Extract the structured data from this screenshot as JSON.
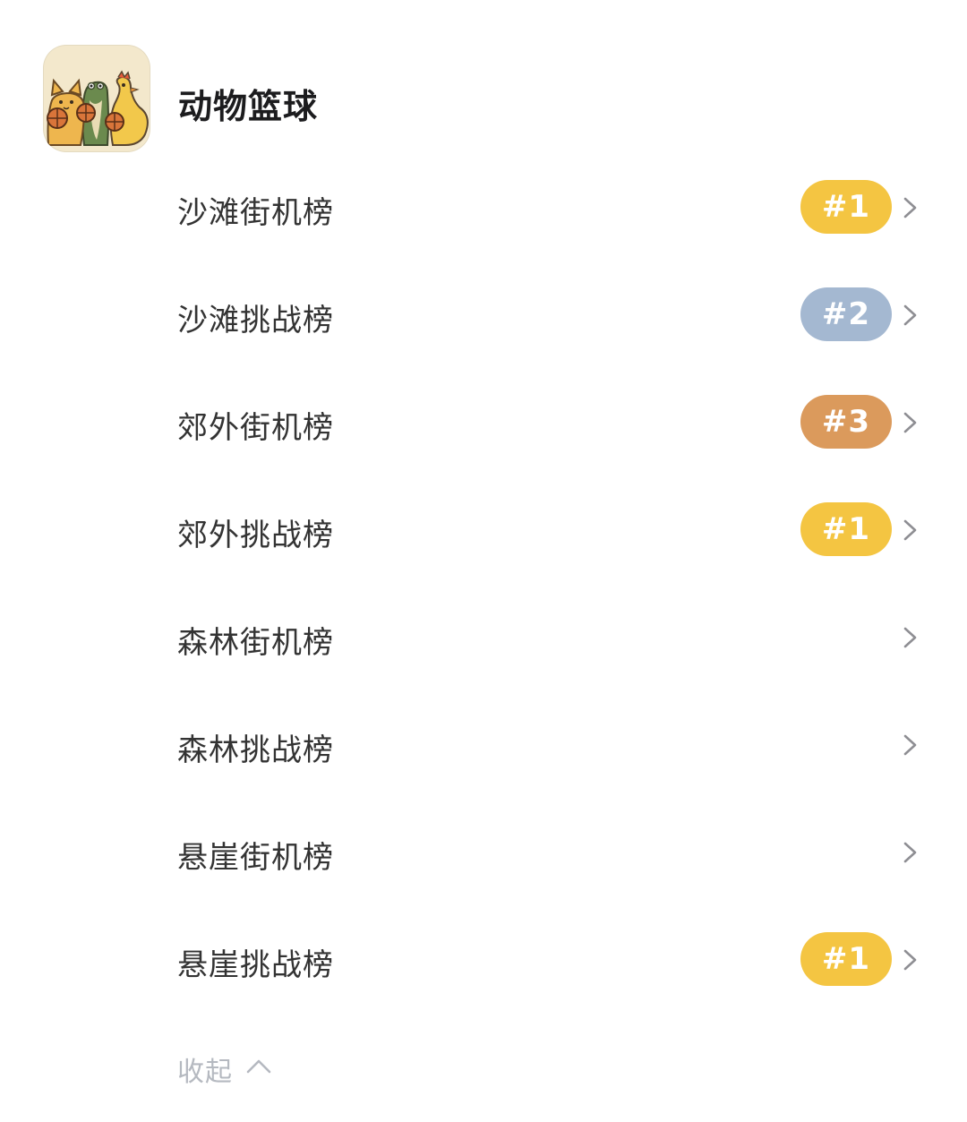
{
  "game": {
    "title": "动物篮球",
    "icon": "animal-basketball-app-icon"
  },
  "boards": [
    {
      "name": "沙滩街机榜",
      "rank": "#1",
      "rank_color": "#f4c542"
    },
    {
      "name": "沙滩挑战榜",
      "rank": "#2",
      "rank_color": "#a4b8d1"
    },
    {
      "name": "郊外街机榜",
      "rank": "#3",
      "rank_color": "#db9a5c"
    },
    {
      "name": "郊外挑战榜",
      "rank": "#1",
      "rank_color": "#f4c542"
    },
    {
      "name": "森林街机榜",
      "rank": "",
      "rank_color": ""
    },
    {
      "name": "森林挑战榜",
      "rank": "",
      "rank_color": ""
    },
    {
      "name": "悬崖街机榜",
      "rank": "",
      "rank_color": ""
    },
    {
      "name": "悬崖挑战榜",
      "rank": "#1",
      "rank_color": "#f4c542"
    }
  ],
  "row_chevron_icon": "chevron-right-icon",
  "collapse": {
    "label": "收起",
    "icon": "chevron-up-icon"
  }
}
